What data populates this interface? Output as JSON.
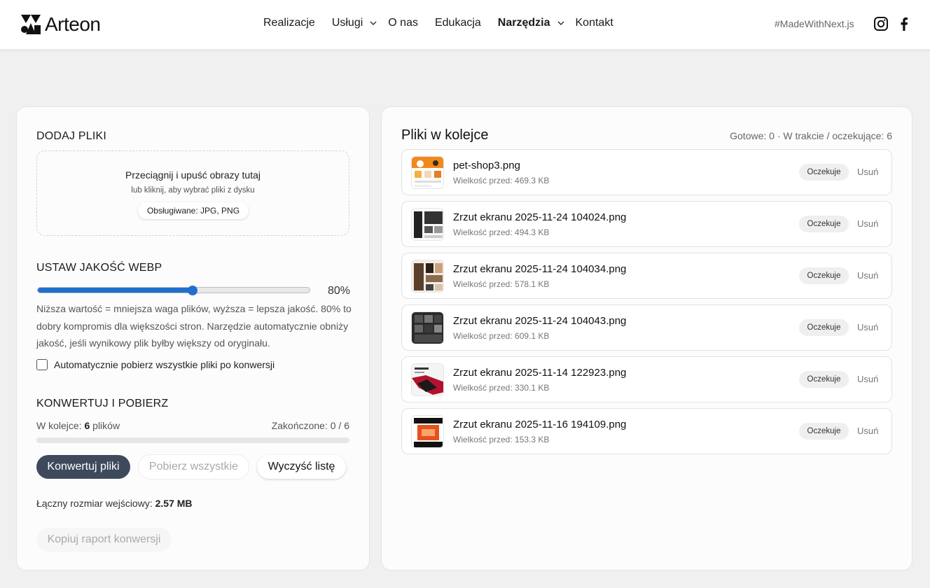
{
  "header": {
    "logo_text": "Arteon",
    "nav": [
      {
        "label": "Realizacje",
        "dropdown": false,
        "active": false
      },
      {
        "label": "Usługi",
        "dropdown": true,
        "active": false
      },
      {
        "label": "O nas",
        "dropdown": false,
        "active": false
      },
      {
        "label": "Edukacja",
        "dropdown": false,
        "active": false
      },
      {
        "label": "Narzędzia",
        "dropdown": true,
        "active": true
      },
      {
        "label": "Kontakt",
        "dropdown": false,
        "active": false
      }
    ],
    "hashtag": "#MadeWithNext.js",
    "social_icons": [
      "instagram-icon",
      "facebook-icon"
    ]
  },
  "upload": {
    "section_title": "DODAJ PLIKI",
    "dropzone_title": "Przeciągnij i upuść obrazy tutaj",
    "dropzone_subtitle": "lub kliknij, aby wybrać pliki z dysku",
    "supported_badge": "Obsługiwane: JPG, PNG"
  },
  "quality": {
    "section_title": "USTAW JAKOŚĆ WEBP",
    "value": 80,
    "value_label": "80%",
    "slider_fill_fraction": 0.57,
    "help_text": "Niższa wartość = mniejsza waga plików, wyższa = lepsza jakość. 80% to dobry kompromis dla większości stron. Narzędzie automatycznie obniży jakość, jeśli wynikowy plik byłby większy od oryginału.",
    "auto_download_label": "Automatycznie pobierz wszystkie pliki po konwersji",
    "auto_download_checked": false
  },
  "convert": {
    "section_title": "KONWERTUJ I POBIERZ",
    "queue_prefix": "W kolejce: ",
    "queue_count": "6",
    "queue_suffix": " plików",
    "done_label": "Zakończone: 0 / 6",
    "progress_fraction": 0,
    "convert_button": "Konwertuj pliki",
    "download_all_button": "Pobierz wszystkie",
    "clear_button": "Wyczyść listę",
    "total_size_prefix": "Łączny rozmiar wejściowy: ",
    "total_size_value": "2.57 MB",
    "report_button": "Kopiuj raport konwersji"
  },
  "queue": {
    "title": "Pliki w kolejce",
    "stats": "Gotowe: 0 · W trakcie / oczekujące: 6",
    "files": [
      {
        "name": "pet-shop3.png",
        "size": "Wielkość przed: 469.3 KB",
        "status": "Oczekuje",
        "remove": "Usuń",
        "thumb": "orange"
      },
      {
        "name": "Zrzut ekranu 2025-11-24 104024.png",
        "size": "Wielkość przed: 494.3 KB",
        "status": "Oczekuje",
        "remove": "Usuń",
        "thumb": "dark"
      },
      {
        "name": "Zrzut ekranu 2025-11-24 104034.png",
        "size": "Wielkość przed: 578.1 KB",
        "status": "Oczekuje",
        "remove": "Usuń",
        "thumb": "brown"
      },
      {
        "name": "Zrzut ekranu 2025-11-24 104043.png",
        "size": "Wielkość przed: 609.1 KB",
        "status": "Oczekuje",
        "remove": "Usuń",
        "thumb": "grid"
      },
      {
        "name": "Zrzut ekranu 2025-11-14 122923.png",
        "size": "Wielkość przed: 330.1 KB",
        "status": "Oczekuje",
        "remove": "Usuń",
        "thumb": "red"
      },
      {
        "name": "Zrzut ekranu 2025-11-16 194109.png",
        "size": "Wielkość przed: 153.3 KB",
        "status": "Oczekuje",
        "remove": "Usuń",
        "thumb": "font"
      }
    ]
  },
  "colors": {
    "accent": "#1f6fcf",
    "primary_button": "#3e4a5c",
    "background": "#f0f0f0"
  }
}
